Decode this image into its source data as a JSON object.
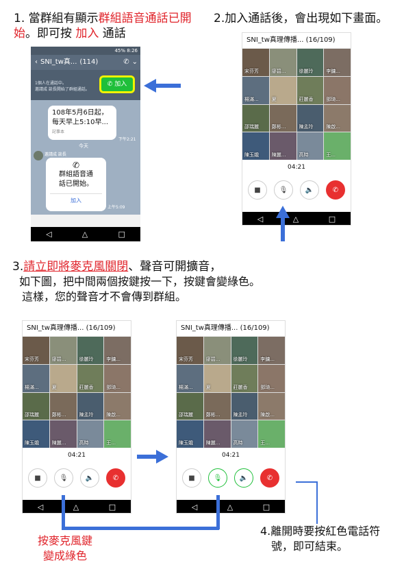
{
  "step1": {
    "num": "1.",
    "text_a": "當群組有顯示",
    "text_red": "群組語音通話已開始",
    "text_b": "。即可按 ",
    "join_red": "加入",
    "text_c": " 通話"
  },
  "step2": {
    "text": "2.加入通話後，會出現如下畫面。"
  },
  "step3": {
    "num": "3.",
    "red_ul": "請立即將麥克風關閉",
    "line1_rest": "、聲音可開擴音，",
    "line2": "如下圖，把中間兩個按鍵按一下，按鍵會變綠色。",
    "line3": "這樣，您的聲音才不會傳到群組。"
  },
  "step4": {
    "line1": "4.離開時要按紅色電話符",
    "line2": "號，即可結束。"
  },
  "mic_note": {
    "line1": "按麥克風鍵",
    "line2": "變成綠色"
  },
  "chat": {
    "time": "8:26",
    "battery": "45%",
    "title": "SNI_tw真...",
    "count": "(114)",
    "join_label": "加入",
    "banner_line1": "1個人在通話中。",
    "banner_line2": "邀請成 談長開始了群組通話。",
    "msg1_line1": "108年5月6日起，",
    "msg1_line2": "每天早上5:10早...",
    "msg1_sub": "記事本",
    "msg1_time": "下午2:21",
    "today": "今天",
    "sender": "邀請成 談長",
    "call_line1": "群組語音通",
    "call_line2": "話已開始。",
    "call_join": "加入",
    "call_time": "上午5:09"
  },
  "call_screen": {
    "title": "SNI_tw真理傳播... (16/109)",
    "timer": "04:21",
    "names": [
      "宋芬芳",
      "廖碧...",
      "徐麗玲",
      "李鏞...",
      "楊滿...",
      "夏",
      "莊麗香",
      "鄧琦...",
      "邵瑞麗",
      "鄭彬...",
      "陳孟玲",
      "陳啟...",
      "陳玉娥",
      "陳麗...",
      "高時",
      "王..."
    ]
  },
  "colors": {
    "red": "#e0242b",
    "blue": "#3b6fd8",
    "green": "#1fbf3a"
  }
}
